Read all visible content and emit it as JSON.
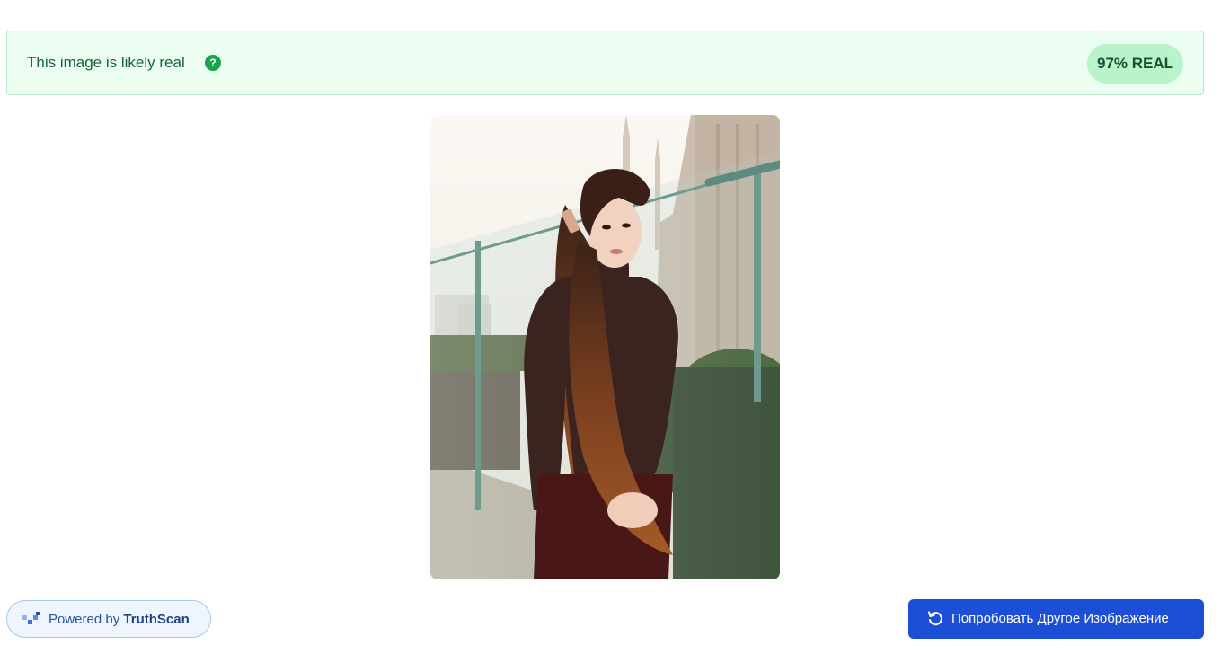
{
  "result": {
    "message": "This image is likely real",
    "help_icon": "?",
    "score_badge": "97% REAL"
  },
  "photo": {
    "subject": "woman-in-brown-turtleneck-on-rooftop"
  },
  "footer": {
    "powered_prefix": "Powered by",
    "powered_brand": "TruthScan",
    "retry_label": "Попробовать Другое Изображение",
    "retry_icon": "rotate-ccw-icon",
    "brand_icon": "pixel-logo-icon"
  },
  "colors": {
    "banner_bg": "#ecfdf1",
    "banner_text": "#17643a",
    "badge_bg": "#b9f3c9",
    "accent_blue": "#1d4ed8"
  }
}
